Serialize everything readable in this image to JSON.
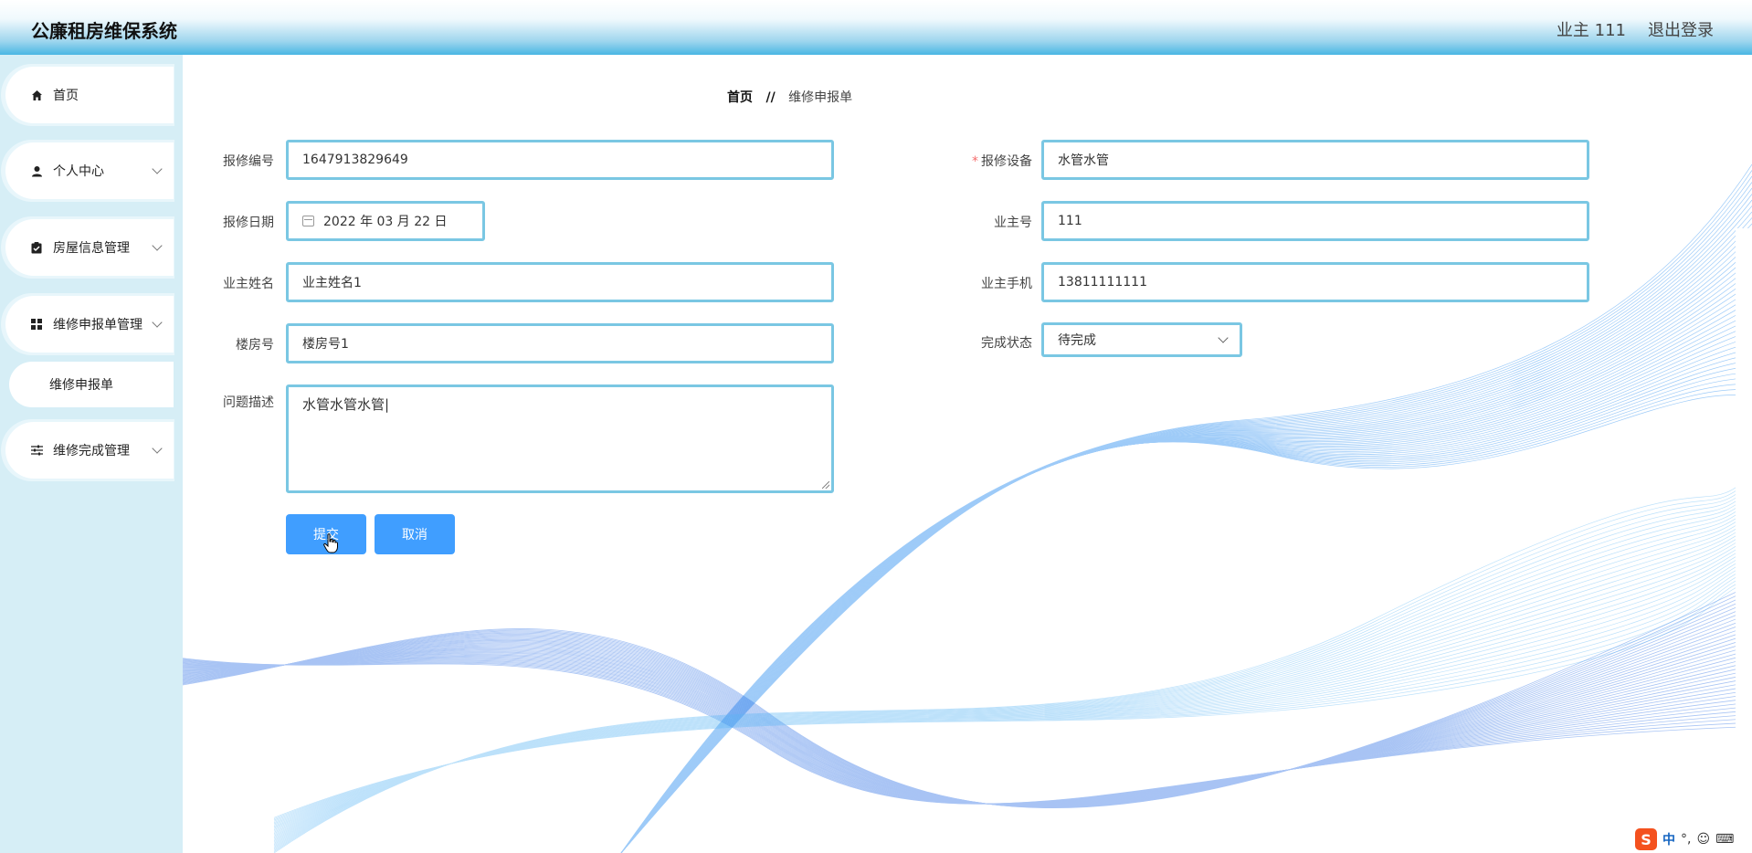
{
  "header": {
    "app_title": "公廉租房维保系统",
    "user_label": "业主 111",
    "logout_label": "退出登录"
  },
  "sidebar": {
    "items": [
      {
        "label": "首页",
        "icon": "home-icon"
      },
      {
        "label": "个人中心",
        "icon": "user-icon"
      },
      {
        "label": "房屋信息管理",
        "icon": "clipboard-icon"
      },
      {
        "label": "维修申报单管理",
        "icon": "grid-icon"
      },
      {
        "label": "维修完成管理",
        "icon": "sliders-icon"
      }
    ],
    "subitem": {
      "label": "维修申报单"
    }
  },
  "breadcrumb": {
    "home": "首页",
    "separator": "//",
    "current": "维修申报单"
  },
  "form": {
    "repair_no": {
      "label": "报修编号",
      "value": "1647913829649"
    },
    "repair_device": {
      "label": "报修设备",
      "value": "水管水管",
      "required_mark": "*"
    },
    "repair_date": {
      "label": "报修日期",
      "value": "2022 年 03 月 22 日"
    },
    "owner_no": {
      "label": "业主号",
      "value": "111"
    },
    "owner_name": {
      "label": "业主姓名",
      "value": "业主姓名1"
    },
    "owner_phone": {
      "label": "业主手机",
      "value": "13811111111"
    },
    "building_no": {
      "label": "楼房号",
      "value": "楼房号1"
    },
    "status": {
      "label": "完成状态",
      "value": "待完成"
    },
    "description": {
      "label": "问题描述",
      "value": "水管水管水管|"
    },
    "submit_label": "提交",
    "cancel_label": "取消"
  },
  "ime": {
    "logo": "S",
    "lang": "中"
  },
  "colors": {
    "accent": "#409eff",
    "field_border": "#7ac7e3",
    "sidebar_bg": "#d6eef6",
    "header_gradient_end": "#49b6e3"
  }
}
